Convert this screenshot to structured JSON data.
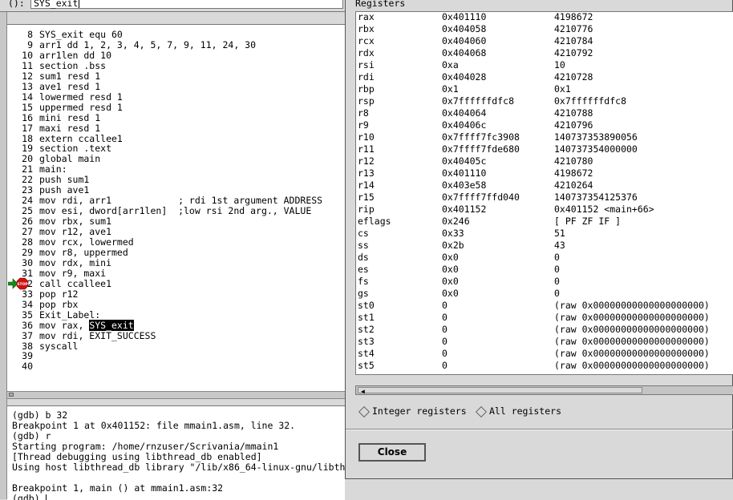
{
  "arg_bar": {
    "label": "():",
    "value": "SYS_exit"
  },
  "source": {
    "lines": [
      {
        "num": "8",
        "code": "SYS_exit equ 60"
      },
      {
        "num": "9",
        "code": "arr1 dd 1, 2, 3, 4, 5, 7, 9, 11, 24, 30"
      },
      {
        "num": "10",
        "code": "arr1len dd 10"
      },
      {
        "num": "11",
        "code": "section .bss"
      },
      {
        "num": "12",
        "code": "sum1 resd 1"
      },
      {
        "num": "13",
        "code": "ave1 resd 1"
      },
      {
        "num": "14",
        "code": "lowermed resd 1"
      },
      {
        "num": "15",
        "code": "uppermed resd 1"
      },
      {
        "num": "16",
        "code": "mini resd 1"
      },
      {
        "num": "17",
        "code": "maxi resd 1"
      },
      {
        "num": "18",
        "code": "extern ccallee1"
      },
      {
        "num": "19",
        "code": "section .text"
      },
      {
        "num": "20",
        "code": "global main"
      },
      {
        "num": "21",
        "code": "main:"
      },
      {
        "num": "22",
        "code": "push sum1"
      },
      {
        "num": "23",
        "code": "push ave1"
      },
      {
        "num": "24",
        "code": "mov rdi, arr1            ; rdi 1st argument ADDRESS"
      },
      {
        "num": "25",
        "code": "mov esi, dword[arr1len]  ;low rsi 2nd arg., VALUE"
      },
      {
        "num": "26",
        "code": "mov rbx, sum1"
      },
      {
        "num": "27",
        "code": "mov r12, ave1"
      },
      {
        "num": "28",
        "code": "mov rcx, lowermed"
      },
      {
        "num": "29",
        "code": "mov r8, uppermed"
      },
      {
        "num": "30",
        "code": "mov rdx, mini"
      },
      {
        "num": "31",
        "code": "mov r9, maxi"
      },
      {
        "num": "32",
        "code": "call ccallee1"
      },
      {
        "num": "33",
        "code": "pop r12"
      },
      {
        "num": "34",
        "code": "pop rbx"
      },
      {
        "num": "35",
        "code": "Exit_Label:"
      },
      {
        "num": "36",
        "code": "mov rax, ",
        "highlight": "SYS_exit"
      },
      {
        "num": "37",
        "code": "mov rdi, EXIT_SUCCESS"
      },
      {
        "num": "38",
        "code": "syscall"
      },
      {
        "num": "39",
        "code": ""
      },
      {
        "num": "40",
        "code": ""
      }
    ],
    "breakpoint_label": "STOP"
  },
  "console": {
    "lines": [
      "(gdb) b 32",
      "Breakpoint 1 at 0x401152: file mmain1.asm, line 32.",
      "(gdb) r",
      "Starting program: /home/rnzuser/Scrivania/mmain1",
      "[Thread debugging using libthread_db enabled]",
      "Using host libthread_db library \"/lib/x86_64-linux-gnu/libth",
      "",
      "Breakpoint 1, main () at mmain1.asm:32",
      "(gdb) "
    ]
  },
  "registers": {
    "title": "Registers",
    "rows": [
      {
        "name": "rax",
        "hex": "0x401110",
        "natural": "4198672"
      },
      {
        "name": "rbx",
        "hex": "0x404058",
        "natural": "4210776"
      },
      {
        "name": "rcx",
        "hex": "0x404060",
        "natural": "4210784"
      },
      {
        "name": "rdx",
        "hex": "0x404068",
        "natural": "4210792"
      },
      {
        "name": "rsi",
        "hex": "0xa",
        "natural": "10"
      },
      {
        "name": "rdi",
        "hex": "0x404028",
        "natural": "4210728"
      },
      {
        "name": "rbp",
        "hex": "0x1",
        "natural": "0x1"
      },
      {
        "name": "rsp",
        "hex": "0x7ffffffdfc8",
        "natural": "0x7ffffffdfc8"
      },
      {
        "name": "r8",
        "hex": "0x404064",
        "natural": "4210788"
      },
      {
        "name": "r9",
        "hex": "0x40406c",
        "natural": "4210796"
      },
      {
        "name": "r10",
        "hex": "0x7ffff7fc3908",
        "natural": "140737353890056"
      },
      {
        "name": "r11",
        "hex": "0x7ffff7fde680",
        "natural": "140737354000000"
      },
      {
        "name": "r12",
        "hex": "0x40405c",
        "natural": "4210780"
      },
      {
        "name": "r13",
        "hex": "0x401110",
        "natural": "4198672"
      },
      {
        "name": "r14",
        "hex": "0x403e58",
        "natural": "4210264"
      },
      {
        "name": "r15",
        "hex": "0x7ffff7ffd040",
        "natural": "140737354125376"
      },
      {
        "name": "rip",
        "hex": "0x401152",
        "natural": "0x401152 <main+66>"
      },
      {
        "name": "eflags",
        "hex": "0x246",
        "natural": "[ PF ZF IF ]"
      },
      {
        "name": "cs",
        "hex": "0x33",
        "natural": "51"
      },
      {
        "name": "ss",
        "hex": "0x2b",
        "natural": "43"
      },
      {
        "name": "ds",
        "hex": "0x0",
        "natural": "0"
      },
      {
        "name": "es",
        "hex": "0x0",
        "natural": "0"
      },
      {
        "name": "fs",
        "hex": "0x0",
        "natural": "0"
      },
      {
        "name": "gs",
        "hex": "0x0",
        "natural": "0"
      },
      {
        "name": "st0",
        "hex": "0",
        "natural": "(raw 0x00000000000000000000)"
      },
      {
        "name": "st1",
        "hex": "0",
        "natural": "(raw 0x00000000000000000000)"
      },
      {
        "name": "st2",
        "hex": "0",
        "natural": "(raw 0x00000000000000000000)"
      },
      {
        "name": "st3",
        "hex": "0",
        "natural": "(raw 0x00000000000000000000)"
      },
      {
        "name": "st4",
        "hex": "0",
        "natural": "(raw 0x00000000000000000000)"
      },
      {
        "name": "st5",
        "hex": "0",
        "natural": "(raw 0x00000000000000000000)"
      }
    ],
    "radio_integer": "Integer registers",
    "radio_all": "All registers",
    "close_label": "Close"
  }
}
